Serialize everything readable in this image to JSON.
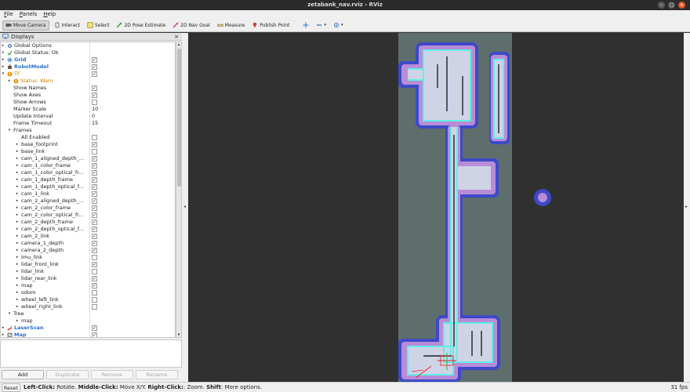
{
  "window": {
    "title": "zetabank_nav.rviz - RViz"
  },
  "menu": [
    {
      "label": "File",
      "mnemonic": "F",
      "rest": "ile"
    },
    {
      "label": "Panels",
      "mnemonic": "P",
      "rest": "anels"
    },
    {
      "label": "Help",
      "mnemonic": "H",
      "rest": "elp"
    }
  ],
  "toolbar": {
    "move_camera": "Move Camera",
    "interact": "Interact",
    "select": "Select",
    "pose_estimate": "2D Pose Estimate",
    "nav_goal": "2D Nav Goal",
    "measure": "Measure",
    "publish_point": "Publish Point"
  },
  "displays_panel": {
    "title": "Displays"
  },
  "tree": [
    {
      "label": "Global Options",
      "depth": 0,
      "arrow": "▸",
      "icon": "gear"
    },
    {
      "label": "Global Status: Ok",
      "depth": 0,
      "arrow": "▸",
      "icon": "check"
    },
    {
      "label": "Grid",
      "depth": 0,
      "arrow": "▸",
      "icon": "grid",
      "style": "blue",
      "checked": true
    },
    {
      "label": "RobotModel",
      "depth": 0,
      "arrow": "▸",
      "icon": "robot",
      "style": "blue",
      "checked": true
    },
    {
      "label": "TF",
      "depth": 0,
      "arrow": "▾",
      "icon": "warn",
      "style": "orange",
      "checked": true
    },
    {
      "label": "Status: Warn",
      "depth": 1,
      "arrow": "▸",
      "icon": "warn",
      "style": "orange"
    },
    {
      "label": "Show Names",
      "depth": 1,
      "checked": true
    },
    {
      "label": "Show Axes",
      "depth": 1,
      "checked": true
    },
    {
      "label": "Show Arrows",
      "depth": 1,
      "checked": false
    },
    {
      "label": "Marker Scale",
      "depth": 1,
      "value": "10"
    },
    {
      "label": "Update Interval",
      "depth": 1,
      "value": "0"
    },
    {
      "label": "Frame Timeout",
      "depth": 1,
      "value": "15"
    },
    {
      "label": "Frames",
      "depth": 1,
      "arrow": "▾"
    },
    {
      "label": "All Enabled",
      "depth": 2,
      "checked": false
    },
    {
      "label": "base_footprint",
      "depth": 2,
      "arrow": "▸",
      "checked": true
    },
    {
      "label": "base_link",
      "depth": 2,
      "arrow": "▸",
      "checked": false
    },
    {
      "label": "cam_1_aligned_depth_...",
      "depth": 2,
      "arrow": "▸",
      "checked": true
    },
    {
      "label": "cam_1_color_frame",
      "depth": 2,
      "arrow": "▸",
      "checked": true
    },
    {
      "label": "cam_1_color_optical_fr...",
      "depth": 2,
      "arrow": "▸",
      "checked": true
    },
    {
      "label": "cam_1_depth_frame",
      "depth": 2,
      "arrow": "▸",
      "checked": true
    },
    {
      "label": "cam_1_depth_optical_f...",
      "depth": 2,
      "arrow": "▸",
      "checked": true
    },
    {
      "label": "cam_1_link",
      "depth": 2,
      "arrow": "▸",
      "checked": true
    },
    {
      "label": "cam_2_aligned_depth_...",
      "depth": 2,
      "arrow": "▸",
      "checked": true
    },
    {
      "label": "cam_2_color_frame",
      "depth": 2,
      "arrow": "▸",
      "checked": true
    },
    {
      "label": "cam_2_color_optical_fr...",
      "depth": 2,
      "arrow": "▸",
      "checked": true
    },
    {
      "label": "cam_2_depth_frame",
      "depth": 2,
      "arrow": "▸",
      "checked": true
    },
    {
      "label": "cam_2_depth_optical_f...",
      "depth": 2,
      "arrow": "▸",
      "checked": true
    },
    {
      "label": "cam_2_link",
      "depth": 2,
      "arrow": "▸",
      "checked": true
    },
    {
      "label": "camera_1_depth",
      "depth": 2,
      "arrow": "▸",
      "checked": true
    },
    {
      "label": "camera_2_depth",
      "depth": 2,
      "arrow": "▸",
      "checked": true
    },
    {
      "label": "imu_link",
      "depth": 2,
      "arrow": "▸",
      "checked": false
    },
    {
      "label": "lidar_front_link",
      "depth": 2,
      "arrow": "▸",
      "checked": true
    },
    {
      "label": "lidar_link",
      "depth": 2,
      "arrow": "▸",
      "checked": false
    },
    {
      "label": "lidar_rear_link",
      "depth": 2,
      "arrow": "▸",
      "checked": true
    },
    {
      "label": "map",
      "depth": 2,
      "arrow": "▸",
      "checked": true
    },
    {
      "label": "odom",
      "depth": 2,
      "arrow": "▸",
      "checked": false
    },
    {
      "label": "wheel_left_link",
      "depth": 2,
      "arrow": "▸",
      "checked": false
    },
    {
      "label": "wheel_right_link",
      "depth": 2,
      "arrow": "▸",
      "checked": false
    },
    {
      "label": "Tree",
      "depth": 1,
      "arrow": "▾"
    },
    {
      "label": "map",
      "depth": 2,
      "arrow": "▸"
    },
    {
      "label": "LaserScan",
      "depth": 0,
      "arrow": "▸",
      "icon": "laser",
      "style": "blue",
      "checked": true
    },
    {
      "label": "Map",
      "depth": 0,
      "arrow": "▸",
      "icon": "map",
      "style": "blue",
      "checked": true
    }
  ],
  "buttons": {
    "add": "Add",
    "duplicate": "Duplicate",
    "remove": "Remove",
    "rename": "Rename"
  },
  "status": {
    "reset": "Reset",
    "hint_parts": [
      {
        "text": "Left-Click:",
        "bold": true
      },
      {
        "text": " Rotate. ",
        "bold": false
      },
      {
        "text": "Middle-Click:",
        "bold": true
      },
      {
        "text": " Move X/Y. ",
        "bold": false
      },
      {
        "text": "Right-Click:",
        "bold": true
      },
      {
        "text": ": Zoom. ",
        "bold": false
      },
      {
        "text": "Shift",
        "bold": true
      },
      {
        "text": ": More options.",
        "bold": false
      }
    ],
    "fps": "31 fps"
  },
  "colors": {
    "viewport_bg": "#303030",
    "map_unknown": "#5e6e6c",
    "costmap_outer": "#3c4ac8",
    "costmap_inner": "#b98cd8",
    "free_space": "#cfd3e6",
    "walls": "#5ff0e6",
    "accent_blue": "#2a6fc9",
    "warn_orange": "#d97b00"
  }
}
